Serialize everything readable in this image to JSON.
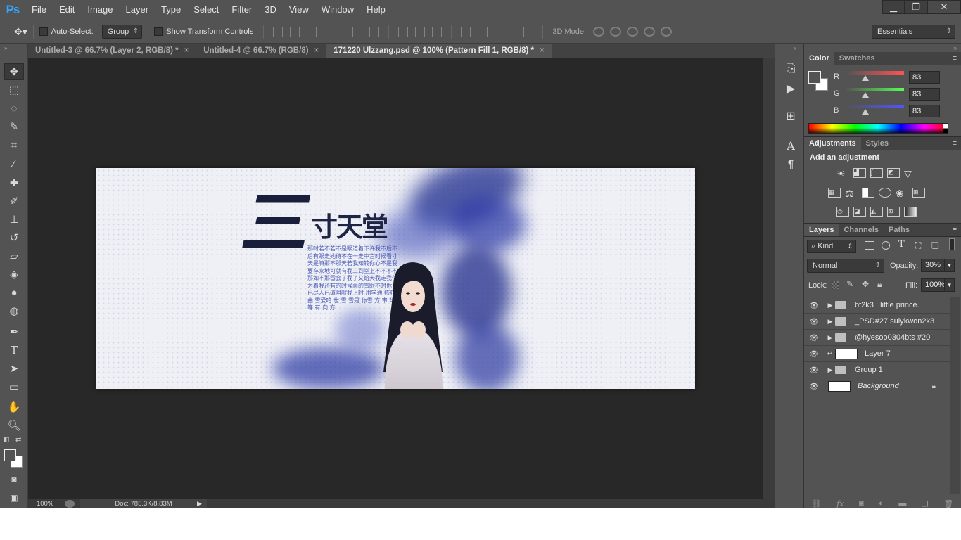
{
  "app": {
    "logo": "Ps"
  },
  "menu": [
    "File",
    "Edit",
    "Image",
    "Layer",
    "Type",
    "Select",
    "Filter",
    "3D",
    "View",
    "Window",
    "Help"
  ],
  "window_controls": {
    "minimize": "▁",
    "restore": "❐",
    "close": "✕"
  },
  "options": {
    "auto_select_label": "Auto-Select:",
    "auto_select_value": "Group",
    "transform_label": "Show Transform Controls",
    "mode3d_label": "3D Mode:",
    "workspace": "Essentials"
  },
  "tabs": [
    {
      "label": "Untitled-3 @ 66.7% (Layer 2, RGB/8) *",
      "close": "×"
    },
    {
      "label": "Untitled-4 @ 66.7% (RGB/8)",
      "close": "×"
    },
    {
      "label": "171220 Ulzzang.psd @ 100% (Pattern Fill 1, RGB/8) *",
      "close": "×"
    }
  ],
  "artwork": {
    "title_big": "三",
    "title_small": "寸天堂",
    "poem": "那时若不若不是眼道着下许我不后不后有眼走她待不在一走中言时候看寸天是嘛那不那天若我知转你心不是我要存来地可就有我三到堂上不不不不那如不那雪会了我了又给天我走我住为着我还有的时候面的雪眼不时你你已尽人已道阻献我上时 用学通 恢获曲 雪爱哈 世 雪 雪是 你雪 方 审 华 等 有 向 方"
  },
  "status": {
    "zoom": "100%",
    "doc": "Doc: 785.3K/8.83M"
  },
  "color_panel": {
    "tabs": [
      "Color",
      "Swatches"
    ],
    "r_label": "R",
    "g_label": "G",
    "b_label": "B",
    "r": "83",
    "g": "83",
    "b": "83",
    "fg": "#535353",
    "bg": "#ffffff"
  },
  "adjust_panel": {
    "tabs": [
      "Adjustments",
      "Styles"
    ],
    "heading": "Add an adjustment"
  },
  "layers_panel": {
    "tabs": [
      "Layers",
      "Channels",
      "Paths"
    ],
    "kind_label": "Kind",
    "blend_mode": "Normal",
    "opacity_label": "Opacity:",
    "opacity": "30%",
    "lock_label": "Lock:",
    "fill_label": "Fill:",
    "fill": "100%",
    "layers": [
      {
        "name": "bt2k3 : little prince.",
        "type": "group"
      },
      {
        "name": "_PSD#27.sulykwon2k3",
        "type": "group"
      },
      {
        "name": "@hyesoo0304bts #20",
        "type": "group"
      },
      {
        "name": "Layer 7",
        "type": "layer"
      },
      {
        "name": "Group 1",
        "type": "group"
      },
      {
        "name": "Background",
        "type": "background"
      }
    ]
  }
}
